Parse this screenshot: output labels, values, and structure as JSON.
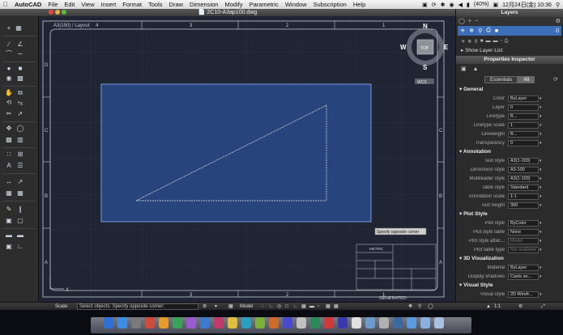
{
  "menubar": {
    "items": [
      "AutoCAD",
      "File",
      "Edit",
      "View",
      "Insert",
      "Format",
      "Tools",
      "Draw",
      "Dimension",
      "Modify",
      "Parametric",
      "Window",
      "Subscription",
      "Help"
    ],
    "battery": "(40%)",
    "datetime": "12月24日(金) 10:36"
  },
  "window": {
    "title": "2C10-A3ap100.dwg"
  },
  "drawing": {
    "tab_top": "A3(150) / Layout",
    "columns": [
      "4",
      "3",
      "2",
      "1"
    ],
    "rows": [
      "D",
      "C",
      "B",
      "A"
    ],
    "compass": {
      "n": "N",
      "s": "S",
      "e": "E",
      "w": "W",
      "center": "TOP"
    },
    "wcs": "WCS",
    "tooltip": "Specify opposite corner",
    "titleblock_label": "METRIC",
    "generated": "GENERATED"
  },
  "layers_panel": {
    "title": "Layers",
    "layer_name": "0",
    "show_list": "Show Layer List"
  },
  "inspector": {
    "title": "Properties Inspector",
    "tabs": [
      "Essentials",
      "All"
    ],
    "active_tab": "All",
    "sections": [
      {
        "title": "General",
        "rows": [
          {
            "label": "Color",
            "value": "ByLayer"
          },
          {
            "label": "Layer",
            "value": "0"
          },
          {
            "label": "Linetype",
            "value": "B..."
          },
          {
            "label": "Linetype scale",
            "value": "1"
          },
          {
            "label": "Lineweight",
            "value": "B..."
          },
          {
            "label": "Transparency",
            "value": "0"
          }
        ]
      },
      {
        "title": "Annotation",
        "rows": [
          {
            "label": "Text style",
            "value": "A3(1-100)"
          },
          {
            "label": "Dimension style",
            "value": "A3-100"
          },
          {
            "label": "Multileader style",
            "value": "A3(1-100)"
          },
          {
            "label": "Table style",
            "value": "Standard"
          },
          {
            "label": "Annotation scale",
            "value": "1:1"
          },
          {
            "label": "Text height",
            "value": "300"
          }
        ]
      },
      {
        "title": "Plot Style",
        "rows": [
          {
            "label": "Plot style",
            "value": "ByColor"
          },
          {
            "label": "Plot style table",
            "value": "None"
          },
          {
            "label": "Plot style attac...",
            "value": "Model"
          },
          {
            "label": "Plot table type",
            "value": "Not available"
          }
        ]
      },
      {
        "title": "3D Visualization",
        "rows": [
          {
            "label": "Material",
            "value": "ByLayer"
          },
          {
            "label": "Display shadows",
            "value": "Casts an..."
          }
        ]
      },
      {
        "title": "Visual Style",
        "rows": [
          {
            "label": "Visual style",
            "value": "2D Wirefr..."
          }
        ]
      }
    ]
  },
  "statusbar": {
    "scale_label": "Scale:",
    "command": "Select objects: Specify opposite corner:",
    "model": "Model",
    "zoom": "1:1"
  }
}
